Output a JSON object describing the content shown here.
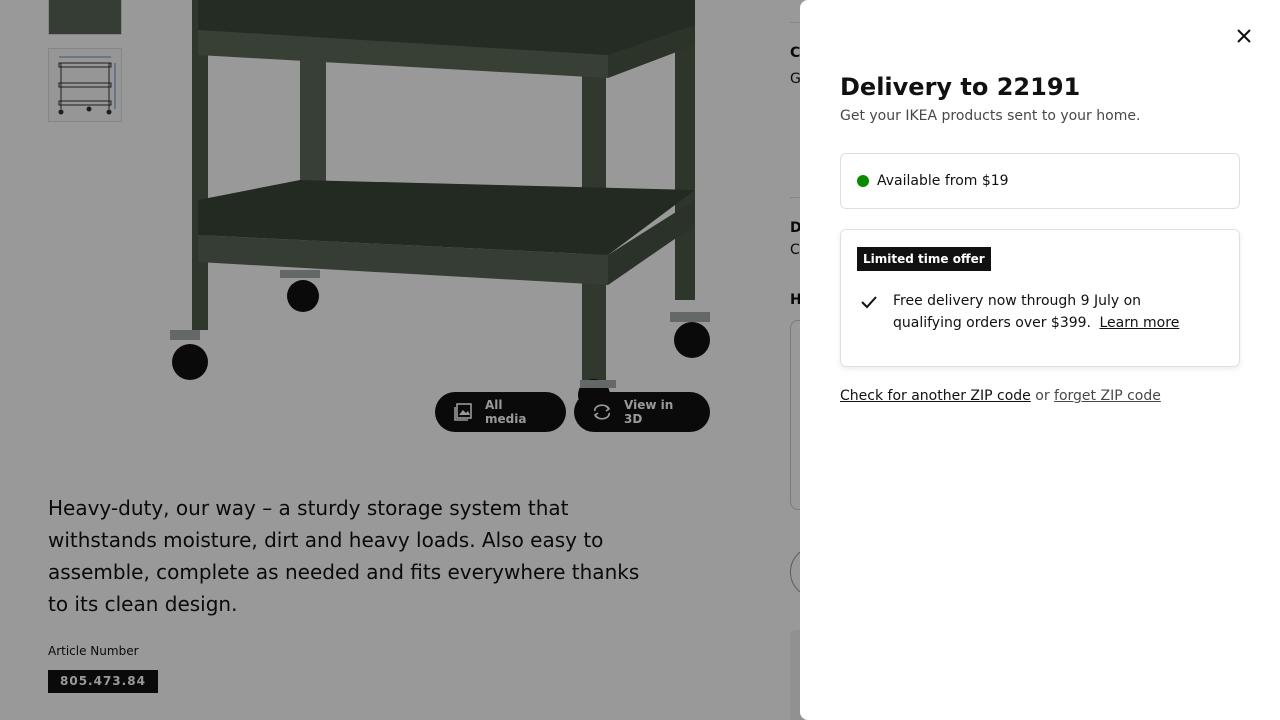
{
  "product_page": {
    "media_buttons": {
      "all_media": "All media",
      "view_3d": "View in 3D"
    },
    "description": "Heavy-duty, our way – a sturdy storage system that withstands moisture, dirt and heavy loads. Also easy to assemble, complete as needed and fits everywhere thanks to its clean design.",
    "article_label": "Article Number",
    "article_number": "805.473.84",
    "right_col_fragments": {
      "c_heading": "C",
      "g_text": "G",
      "d_heading": "D",
      "c_text": "C",
      "h_heading": "H"
    }
  },
  "delivery_panel": {
    "title": "Delivery to 22191",
    "subtitle": "Get your IKEA products sent to your home.",
    "availability": "Available from $19",
    "availability_color": "#0a8a00",
    "offer": {
      "badge": "Limited time offer",
      "text": "Free delivery now through 9 July on qualifying orders over $399.",
      "link": "Learn more"
    },
    "zip": {
      "check_link": "Check for another ZIP code",
      "or": "or",
      "forget_link": "forget ZIP code"
    },
    "close_icon": "close-icon"
  }
}
